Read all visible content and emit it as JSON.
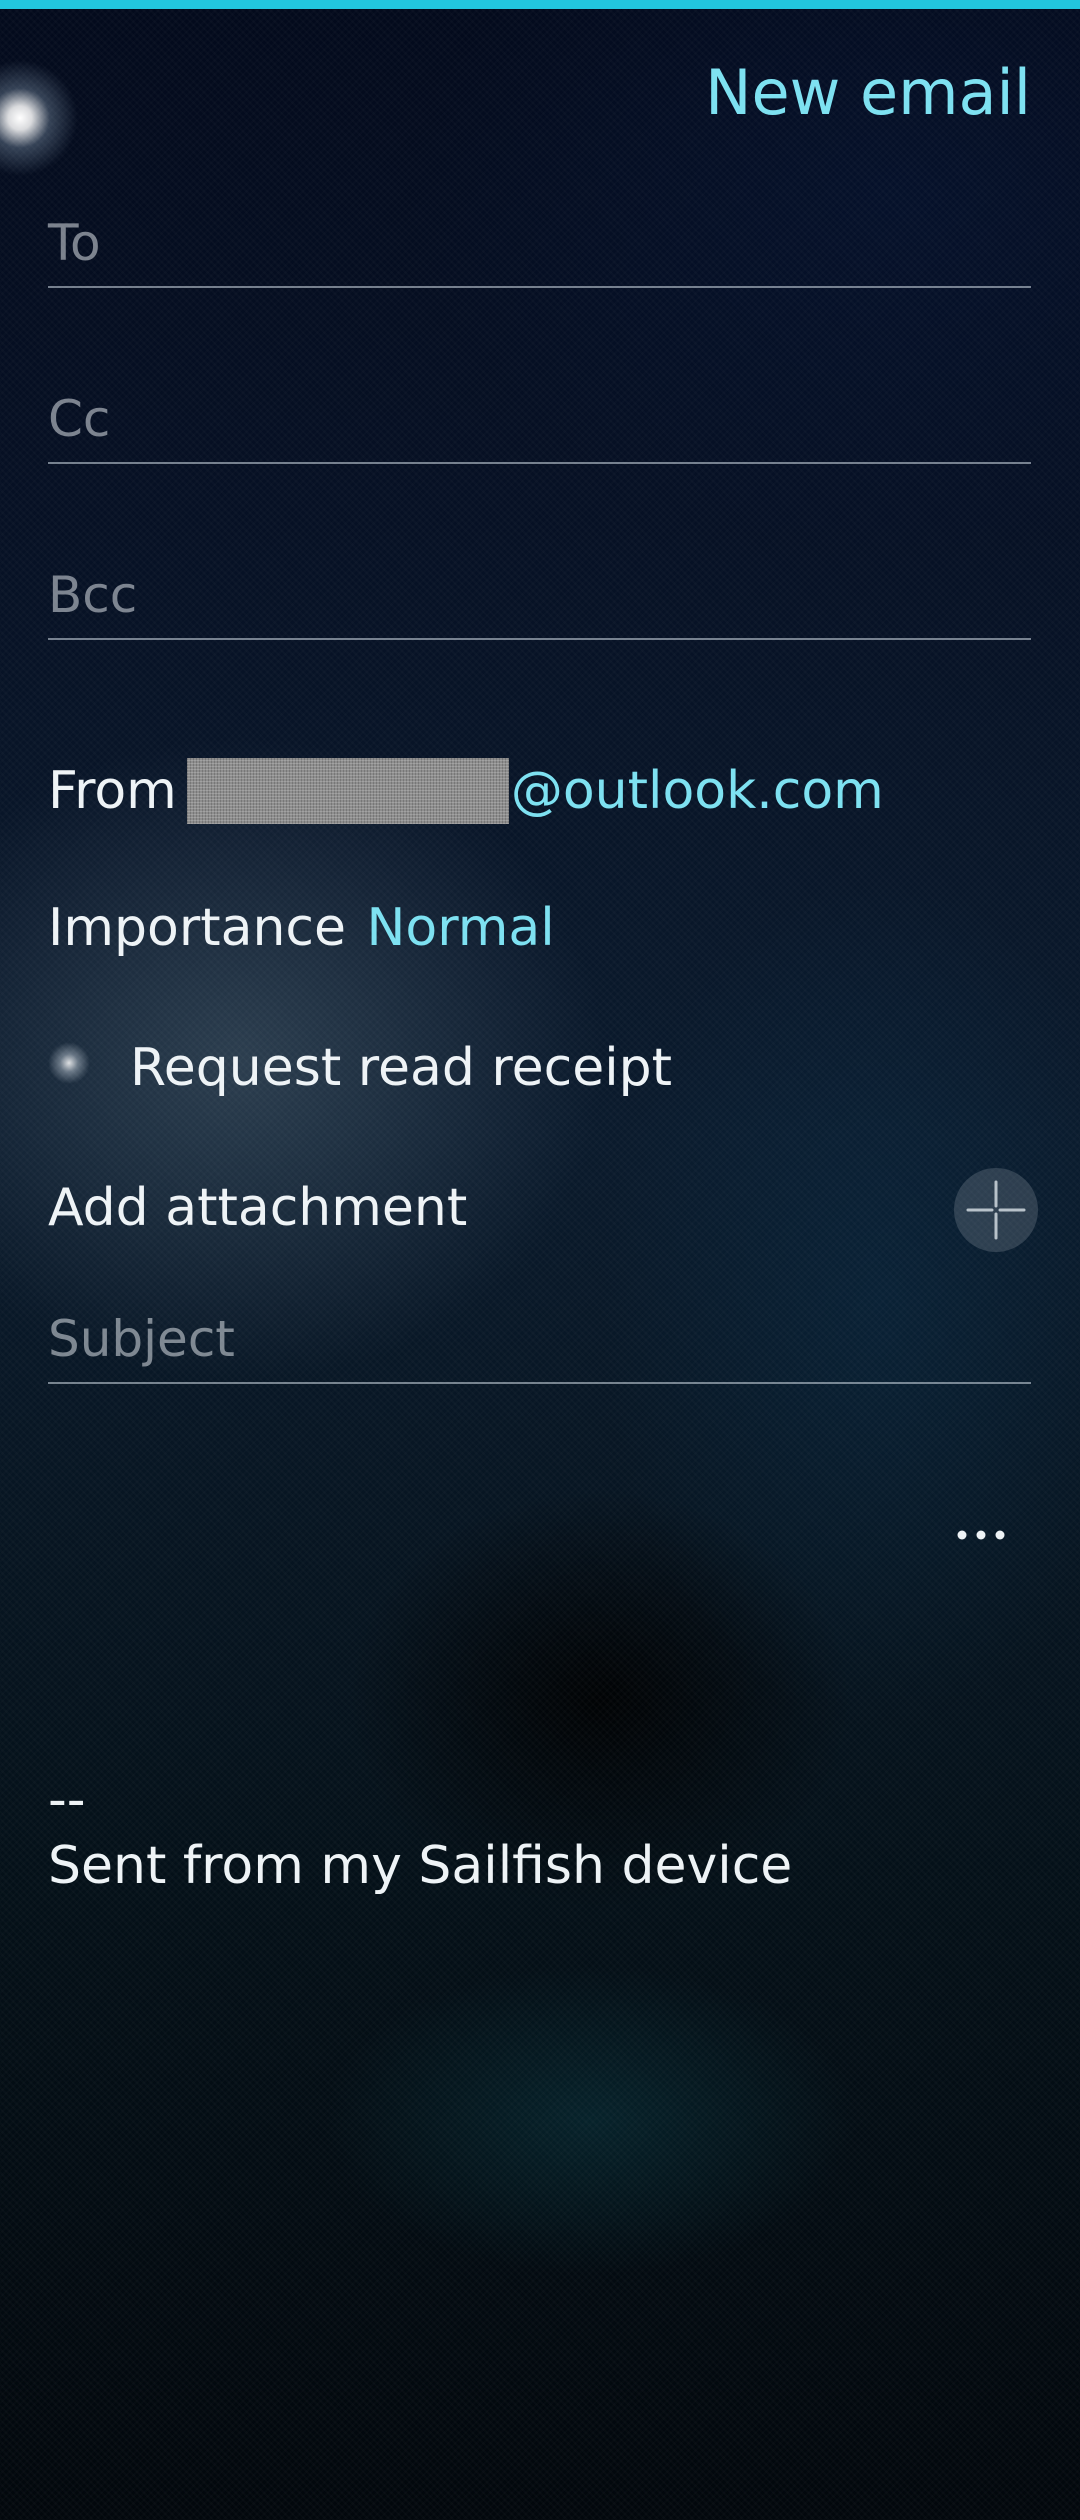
{
  "header": {
    "title": "New email"
  },
  "recipients": {
    "to_placeholder": "To",
    "cc_placeholder": "Cc",
    "bcc_placeholder": "Bcc"
  },
  "from": {
    "label": "From",
    "address_suffix": "@outlook.com"
  },
  "importance": {
    "label": "Importance",
    "value": "Normal"
  },
  "read_receipt": {
    "label": "Request read receipt",
    "enabled": false
  },
  "attachment": {
    "label": "Add attachment",
    "icon": "plus-icon"
  },
  "subject": {
    "placeholder": "Subject"
  },
  "body": {
    "more_icon": "more-icon",
    "signature_separator": "--",
    "signature_text": "Sent from my Sailfish device"
  },
  "colors": {
    "accent": "#7ee1f1",
    "top_bar": "#22c6de",
    "text": "#eef3f6"
  }
}
